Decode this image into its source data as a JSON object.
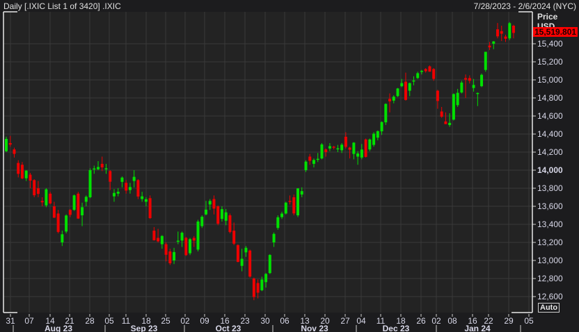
{
  "header": {
    "title": "Daily [.IXIC List 1 of 3420] .IXIC",
    "date_range": "7/28/2023 - 2/6/2024 (NYC)"
  },
  "price_axis": {
    "title": "Price",
    "currency": "USD",
    "last_value": "15,519.801",
    "auto_button": "Auto",
    "ticks": [
      "15,400",
      "15,200",
      "15,000",
      "14,800",
      "14,600",
      "14,400",
      "14,200",
      "14,000",
      "13,800",
      "13,600",
      "13,400",
      "13,200",
      "13,000",
      "12,800",
      "12,600"
    ]
  },
  "x_axis": {
    "day_ticks": [
      "31",
      "07",
      "14",
      "21",
      "28",
      "05",
      "11",
      "18",
      "25",
      "02",
      "09",
      "16",
      "23",
      "30",
      "06",
      "13",
      "20",
      "27",
      "04",
      "11",
      "18",
      "26",
      "02",
      "08",
      "16",
      "22",
      "29",
      "05"
    ],
    "months": [
      "Aug 23",
      "Sep 23",
      "Oct 23",
      "Nov 23",
      "Dec 23",
      "Jan 24"
    ]
  },
  "colors": {
    "up": "#00e000",
    "down": "#ee0000",
    "background": "#1c1c1e",
    "plot": "#232323",
    "grid": "#3a3a3a"
  },
  "chart_data": {
    "type": "candlestick",
    "ylim": [
      12500,
      15650
    ],
    "grid": true,
    "columns": [
      "date",
      "open",
      "high",
      "low",
      "close"
    ],
    "rows": [
      [
        "2023-07-31",
        14210,
        14370,
        14200,
        14346
      ],
      [
        "2023-08-01",
        14300,
        14380,
        14260,
        14283
      ],
      [
        "2023-08-02",
        14230,
        14250,
        14140,
        14180
      ],
      [
        "2023-08-03",
        14080,
        14110,
        13920,
        13959
      ],
      [
        "2023-08-04",
        14060,
        14090,
        13900,
        13909
      ],
      [
        "2023-08-07",
        13910,
        14000,
        13880,
        13994
      ],
      [
        "2023-08-08",
        13950,
        13970,
        13800,
        13884
      ],
      [
        "2023-08-09",
        13890,
        13900,
        13700,
        13722
      ],
      [
        "2023-08-10",
        13800,
        13880,
        13700,
        13737
      ],
      [
        "2023-08-11",
        13660,
        13700,
        13600,
        13644
      ],
      [
        "2023-08-14",
        13610,
        13800,
        13590,
        13788
      ],
      [
        "2023-08-15",
        13740,
        13760,
        13620,
        13631
      ],
      [
        "2023-08-16",
        13600,
        13650,
        13470,
        13474
      ],
      [
        "2023-08-17",
        13520,
        13560,
        13300,
        13316
      ],
      [
        "2023-08-18",
        13200,
        13330,
        13160,
        13290
      ],
      [
        "2023-08-21",
        13320,
        13510,
        13300,
        13498
      ],
      [
        "2023-08-22",
        13560,
        13570,
        13480,
        13505
      ],
      [
        "2023-08-23",
        13560,
        13730,
        13550,
        13721
      ],
      [
        "2023-08-24",
        13740,
        13760,
        13460,
        13464
      ],
      [
        "2023-08-25",
        13500,
        13640,
        13380,
        13590
      ],
      [
        "2023-08-28",
        13650,
        13720,
        13600,
        13705
      ],
      [
        "2023-08-29",
        13700,
        14020,
        13690,
        14000
      ],
      [
        "2023-08-30",
        14010,
        14050,
        13960,
        14019
      ],
      [
        "2023-08-31",
        14010,
        14100,
        14000,
        14035
      ],
      [
        "2023-09-01",
        14070,
        14150,
        13990,
        14031
      ],
      [
        "2023-09-05",
        14020,
        14070,
        13960,
        14021
      ],
      [
        "2023-09-06",
        13990,
        14000,
        13780,
        13872
      ],
      [
        "2023-09-07",
        13710,
        13790,
        13650,
        13748
      ],
      [
        "2023-09-08",
        13740,
        13800,
        13710,
        13761
      ],
      [
        "2023-09-11",
        13870,
        13930,
        13810,
        13918
      ],
      [
        "2023-09-12",
        13860,
        13890,
        13740,
        13774
      ],
      [
        "2023-09-13",
        13780,
        13860,
        13740,
        13813
      ],
      [
        "2023-09-14",
        13880,
        14000,
        13810,
        13926
      ],
      [
        "2023-09-15",
        13890,
        13900,
        13680,
        13708
      ],
      [
        "2023-09-18",
        13680,
        13760,
        13650,
        13710
      ],
      [
        "2023-09-19",
        13650,
        13700,
        13600,
        13678
      ],
      [
        "2023-09-20",
        13690,
        13720,
        13460,
        13469
      ],
      [
        "2023-09-21",
        13330,
        13370,
        13220,
        13224
      ],
      [
        "2023-09-22",
        13250,
        13350,
        13200,
        13212
      ],
      [
        "2023-09-25",
        13180,
        13280,
        13130,
        13271
      ],
      [
        "2023-09-26",
        13180,
        13200,
        12990,
        13063
      ],
      [
        "2023-09-27",
        13100,
        13130,
        12950,
        12969
      ],
      [
        "2023-09-28",
        13000,
        13140,
        12960,
        13093
      ],
      [
        "2023-09-29",
        13210,
        13320,
        13180,
        13219
      ],
      [
        "2023-10-02",
        13220,
        13320,
        13150,
        13307
      ],
      [
        "2023-10-03",
        13250,
        13260,
        13050,
        13059
      ],
      [
        "2023-10-04",
        13080,
        13250,
        13060,
        13236
      ],
      [
        "2023-10-05",
        13250,
        13270,
        13150,
        13220
      ],
      [
        "2023-10-06",
        13120,
        13450,
        13100,
        13431
      ],
      [
        "2023-10-09",
        13380,
        13500,
        13360,
        13484
      ],
      [
        "2023-10-10",
        13510,
        13660,
        13500,
        13563
      ],
      [
        "2023-10-11",
        13620,
        13680,
        13560,
        13659
      ],
      [
        "2023-10-12",
        13680,
        13720,
        13510,
        13574
      ],
      [
        "2023-10-13",
        13600,
        13610,
        13390,
        13407
      ],
      [
        "2023-10-16",
        13460,
        13600,
        13430,
        13568
      ],
      [
        "2023-10-17",
        13440,
        13570,
        13390,
        13533
      ],
      [
        "2023-10-18",
        13500,
        13520,
        13300,
        13315
      ],
      [
        "2023-10-19",
        13330,
        13420,
        13170,
        13186
      ],
      [
        "2023-10-20",
        13170,
        13180,
        12980,
        12984
      ],
      [
        "2023-10-23",
        12940,
        13130,
        12880,
        13019
      ],
      [
        "2023-10-24",
        13090,
        13160,
        13040,
        13140
      ],
      [
        "2023-10-25",
        13110,
        13120,
        12810,
        12821
      ],
      [
        "2023-10-26",
        12800,
        12810,
        12560,
        12595
      ],
      [
        "2023-10-27",
        12750,
        12790,
        12580,
        12643
      ],
      [
        "2023-10-30",
        12670,
        12820,
        12660,
        12789
      ],
      [
        "2023-10-31",
        12760,
        12860,
        12700,
        12851
      ],
      [
        "2023-11-01",
        12860,
        13070,
        12850,
        13061
      ],
      [
        "2023-11-02",
        13200,
        13310,
        13150,
        13294
      ],
      [
        "2023-11-03",
        13360,
        13500,
        13340,
        13478
      ],
      [
        "2023-11-06",
        13480,
        13540,
        13460,
        13519
      ],
      [
        "2023-11-07",
        13520,
        13650,
        13510,
        13640
      ],
      [
        "2023-11-08",
        13660,
        13720,
        13620,
        13651
      ],
      [
        "2023-11-09",
        13700,
        13730,
        13500,
        13521
      ],
      [
        "2023-11-10",
        13500,
        13800,
        13480,
        13798
      ],
      [
        "2023-11-13",
        13730,
        13810,
        13700,
        13768
      ],
      [
        "2023-11-14",
        14000,
        14110,
        13980,
        14094
      ],
      [
        "2023-11-15",
        14150,
        14180,
        14060,
        14104
      ],
      [
        "2023-11-16",
        14070,
        14130,
        14030,
        14113
      ],
      [
        "2023-11-17",
        14120,
        14190,
        14090,
        14126
      ],
      [
        "2023-11-20",
        14130,
        14300,
        14120,
        14285
      ],
      [
        "2023-11-21",
        14230,
        14240,
        14150,
        14200
      ],
      [
        "2023-11-22",
        14240,
        14300,
        14210,
        14266
      ],
      [
        "2023-11-24",
        14260,
        14270,
        14230,
        14251
      ],
      [
        "2023-11-27",
        14230,
        14280,
        14200,
        14242
      ],
      [
        "2023-11-28",
        14220,
        14300,
        14190,
        14282
      ],
      [
        "2023-11-29",
        14370,
        14420,
        14240,
        14258
      ],
      [
        "2023-11-30",
        14250,
        14260,
        14130,
        14226
      ],
      [
        "2023-12-01",
        14180,
        14310,
        14120,
        14305
      ],
      [
        "2023-12-04",
        14150,
        14210,
        14060,
        14185
      ],
      [
        "2023-12-05",
        14140,
        14290,
        14120,
        14229
      ],
      [
        "2023-12-06",
        14340,
        14350,
        14140,
        14147
      ],
      [
        "2023-12-07",
        14230,
        14350,
        14210,
        14340
      ],
      [
        "2023-12-08",
        14280,
        14420,
        14260,
        14404
      ],
      [
        "2023-12-11",
        14360,
        14440,
        14330,
        14432
      ],
      [
        "2023-12-12",
        14430,
        14540,
        14390,
        14533
      ],
      [
        "2023-12-13",
        14530,
        14740,
        14500,
        14734
      ],
      [
        "2023-12-14",
        14790,
        14850,
        14640,
        14762
      ],
      [
        "2023-12-15",
        14770,
        14830,
        14740,
        14814
      ],
      [
        "2023-12-18",
        14820,
        14910,
        14810,
        14905
      ],
      [
        "2023-12-19",
        14930,
        15010,
        14920,
        14964
      ],
      [
        "2023-12-20",
        14980,
        15080,
        14770,
        14778
      ],
      [
        "2023-12-21",
        14880,
        14970,
        14820,
        14964
      ],
      [
        "2023-12-22",
        14990,
        15040,
        14940,
        14993
      ],
      [
        "2023-12-26",
        15020,
        15090,
        15010,
        15074
      ],
      [
        "2023-12-27",
        15090,
        15110,
        15060,
        15100
      ],
      [
        "2023-12-28",
        15120,
        15130,
        15080,
        15096
      ],
      [
        "2023-12-29",
        15150,
        15160,
        15090,
        15091
      ],
      [
        "2023-12-31",
        15120,
        15130,
        14990,
        15011
      ],
      [
        "2024-01-02",
        14880,
        14890,
        14680,
        14766
      ],
      [
        "2024-01-03",
        14650,
        14700,
        14580,
        14592
      ],
      [
        "2024-01-04",
        14540,
        14640,
        14510,
        14510
      ],
      [
        "2024-01-05",
        14500,
        14630,
        14480,
        14524
      ],
      [
        "2024-01-08",
        14560,
        14850,
        14550,
        14843
      ],
      [
        "2024-01-09",
        14720,
        14900,
        14700,
        14857
      ],
      [
        "2024-01-10",
        14860,
        14990,
        14850,
        14970
      ],
      [
        "2024-01-11",
        15020,
        15060,
        14800,
        15003
      ],
      [
        "2024-01-12",
        15020,
        15050,
        14960,
        14990
      ],
      [
        "2024-01-16",
        14910,
        15010,
        14870,
        14944
      ],
      [
        "2024-01-17",
        14850,
        14860,
        14710,
        14855
      ],
      [
        "2024-01-18",
        14930,
        15070,
        14920,
        15056
      ],
      [
        "2024-01-19",
        15110,
        15310,
        15090,
        15311
      ],
      [
        "2024-01-22",
        15380,
        15420,
        15330,
        15360
      ],
      [
        "2024-01-23",
        15400,
        15430,
        15340,
        15426
      ],
      [
        "2024-01-24",
        15560,
        15630,
        15460,
        15482
      ],
      [
        "2024-01-25",
        15540,
        15600,
        15430,
        15511
      ],
      [
        "2024-01-26",
        15480,
        15500,
        15420,
        15455
      ],
      [
        "2024-01-29",
        15460,
        15640,
        15440,
        15628
      ],
      [
        "2024-01-30",
        15600,
        15610,
        15460,
        15519.801
      ]
    ]
  }
}
